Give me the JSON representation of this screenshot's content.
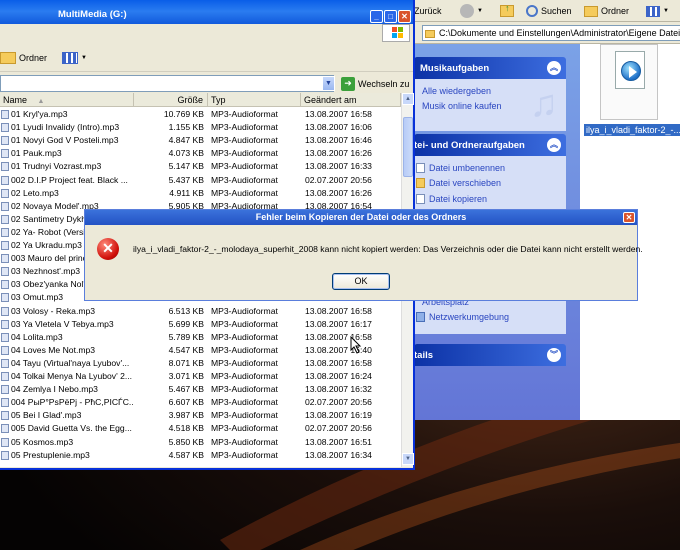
{
  "left_window": {
    "title": "MultiMedia (G:)",
    "toolbar_folders": "Ordner",
    "go_button": "Wechseln zu",
    "columns": {
      "name": "Name",
      "size": "Größe",
      "type": "Typ",
      "modified": "Geändert am"
    },
    "files": [
      {
        "name": "01 Kryl'ya.mp3",
        "size": "10.769 KB",
        "type": "MP3-Audioformat",
        "date": "13.08.2007 16:58"
      },
      {
        "name": "01 Lyudi Invalidy (Intro).mp3",
        "size": "1.155 KB",
        "type": "MP3-Audioformat",
        "date": "13.08.2007 16:06"
      },
      {
        "name": "01 Novyi God V Posteli.mp3",
        "size": "4.847 KB",
        "type": "MP3-Audioformat",
        "date": "13.08.2007 16:46"
      },
      {
        "name": "01 Pauk.mp3",
        "size": "4.073 KB",
        "type": "MP3-Audioformat",
        "date": "13.08.2007 16:26"
      },
      {
        "name": "01 Trudnyi Vozrast.mp3",
        "size": "5.147 KB",
        "type": "MP3-Audioformat",
        "date": "13.08.2007 16:33"
      },
      {
        "name": "002 D.I.P Project feat. Black ...",
        "size": "5.437 KB",
        "type": "MP3-Audioformat",
        "date": "02.07.2007 20:56"
      },
      {
        "name": "02 Leto.mp3",
        "size": "4.911 KB",
        "type": "MP3-Audioformat",
        "date": "13.08.2007 16:26"
      },
      {
        "name": "02 Novaya Model'.mp3",
        "size": "5.905 KB",
        "type": "MP3-Audioformat",
        "date": "13.08.2007 16:54"
      },
      {
        "name": "02 Santimetry Dykh",
        "size": "",
        "type": "",
        "date": ""
      },
      {
        "name": "02 Ya- Robot (Versi",
        "size": "",
        "type": "",
        "date": ""
      },
      {
        "name": "02 Ya Ukradu.mp3",
        "size": "",
        "type": "",
        "date": ""
      },
      {
        "name": "003 Mauro del princ",
        "size": "",
        "type": "",
        "date": ""
      },
      {
        "name": "03 Nezhnost'.mp3",
        "size": "",
        "type": "",
        "date": ""
      },
      {
        "name": "03 Obez'yanka Nol'",
        "size": "",
        "type": "",
        "date": ""
      },
      {
        "name": "03 Omut.mp3",
        "size": "",
        "type": "",
        "date": ""
      },
      {
        "name": "03 Volosy - Reka.mp3",
        "size": "6.513 KB",
        "type": "MP3-Audioformat",
        "date": "13.08.2007 16:58"
      },
      {
        "name": "03 Ya Vletela V Tebya.mp3",
        "size": "5.699 KB",
        "type": "MP3-Audioformat",
        "date": "13.08.2007 16:17"
      },
      {
        "name": "04 Lolita.mp3",
        "size": "5.789 KB",
        "type": "MP3-Audioformat",
        "date": "13.08.2007 16:58"
      },
      {
        "name": "04 Loves Me Not.mp3",
        "size": "4.547 KB",
        "type": "MP3-Audioformat",
        "date": "13.08.2007 16:40"
      },
      {
        "name": "04 Tayu (Virtual'naya Lyubov'...",
        "size": "8.071 KB",
        "type": "MP3-Audioformat",
        "date": "13.08.2007 16:58"
      },
      {
        "name": "04 Tolkai Menya Na Lyubov' 2...",
        "size": "3.071 KB",
        "type": "MP3-Audioformat",
        "date": "13.08.2007 16:24"
      },
      {
        "name": "04 Zemlya I Nebo.mp3",
        "size": "5.467 KB",
        "type": "MP3-Audioformat",
        "date": "13.08.2007 16:32"
      },
      {
        "name": "004 PыP°PsPёPj - PћC,PICЃC...",
        "size": "6.607 KB",
        "type": "MP3-Audioformat",
        "date": "02.07.2007 20:56"
      },
      {
        "name": "05 Bei I Glad'.mp3",
        "size": "3.987 KB",
        "type": "MP3-Audioformat",
        "date": "13.08.2007 16:19"
      },
      {
        "name": "005 David Guetta Vs. the Egg...",
        "size": "4.518 KB",
        "type": "MP3-Audioformat",
        "date": "02.07.2007 20:56"
      },
      {
        "name": "05 Kosmos.mp3",
        "size": "5.850 KB",
        "type": "MP3-Audioformat",
        "date": "13.08.2007 16:51"
      },
      {
        "name": "05 Prestuplenie.mp3",
        "size": "4.587 KB",
        "type": "MP3-Audioformat",
        "date": "13.08.2007 16:34"
      }
    ]
  },
  "right_window": {
    "toolbar_back": "Zurück",
    "toolbar_search": "Suchen",
    "toolbar_folders": "Ordner",
    "address": "C:\\Dokumente und Einstellungen\\Administrator\\Eigene Dateien\\E",
    "music_panel": {
      "title": "Musikaufgaben",
      "items": [
        "Alle wiedergeben",
        "Musik online kaufen"
      ]
    },
    "file_panel": {
      "title": "tei- und Ordneraufgaben",
      "items": [
        "Datei umbenennen",
        "Datei verschieben",
        "Datei kopieren"
      ]
    },
    "other_items": [
      "Arbeitsplatz",
      "Netzwerkumgebung"
    ],
    "details_title": "tails",
    "file_label": "ilya_i_vladi_faktor-2_-..."
  },
  "dialog": {
    "title": "Fehler beim Kopieren der Datei oder des Ordners",
    "message": "ilya_i_vladi_faktor-2_-_molodaya_superhit_2008 kann nicht kopiert werden: Das Verzeichnis oder die Datei kann nicht erstellt werden.",
    "ok_label": "OK"
  },
  "colors": {
    "xp_blue": "#0a5ee8",
    "task_pane": "#6375d6",
    "link_blue": "#2a46c0",
    "selection": "#316ac5",
    "error_red": "#d0100a"
  }
}
